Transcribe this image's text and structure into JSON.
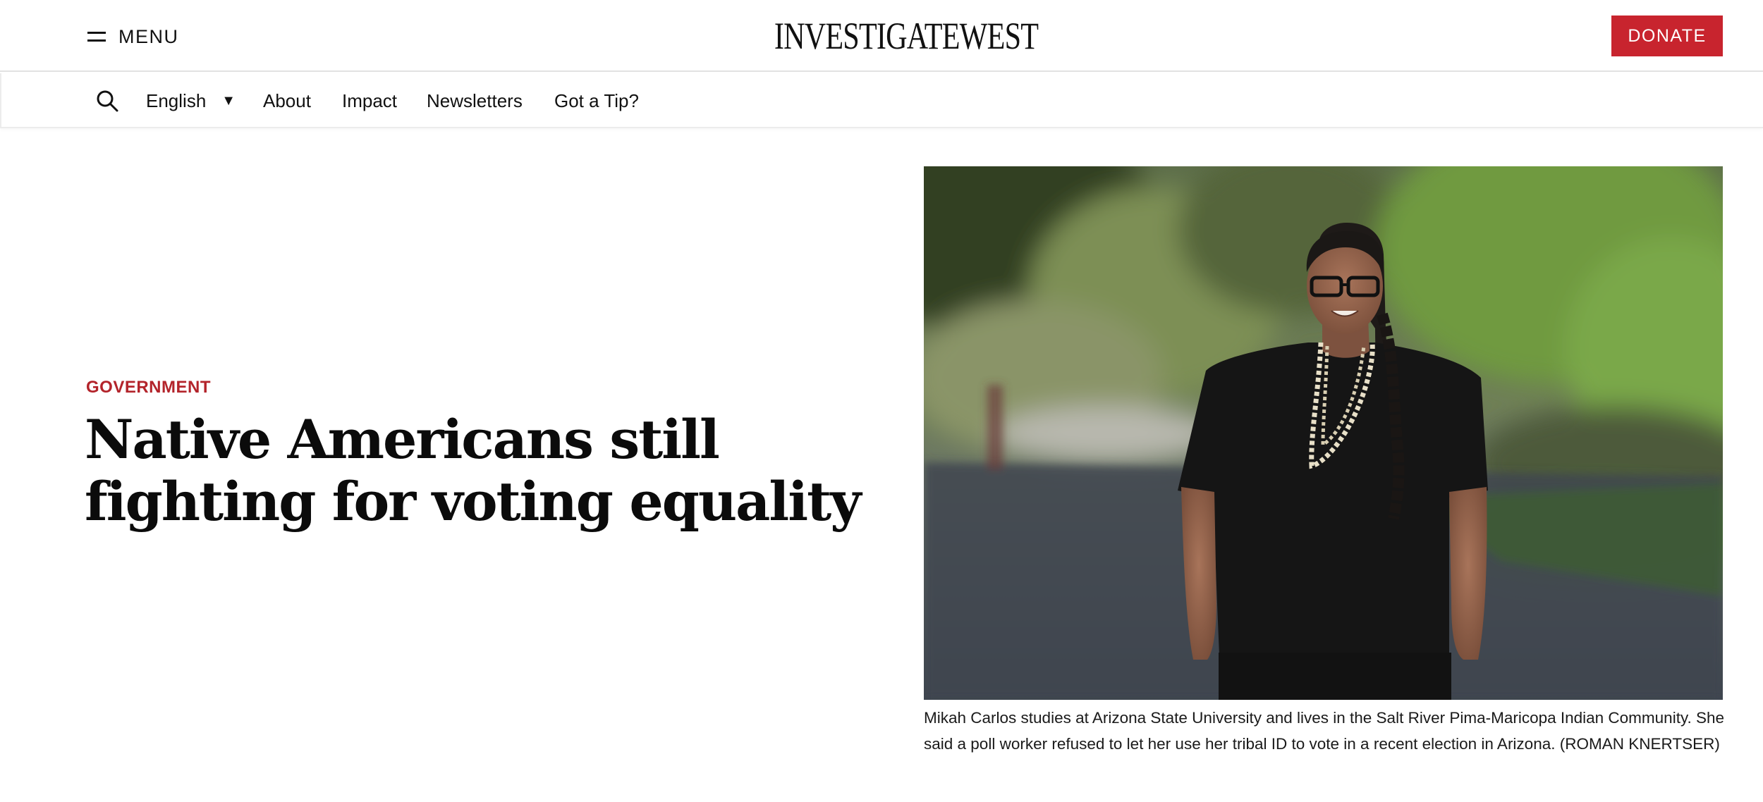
{
  "header": {
    "menu_label": "MENU",
    "logo_text": "INVESTIGATEWEST",
    "donate_label": "DONATE",
    "accent_color": "#c8242e"
  },
  "subnav": {
    "search_icon": "search-icon",
    "language": {
      "selected": "English",
      "caret": "▼"
    },
    "links": [
      "About",
      "Impact",
      "Newsletters",
      "Got a Tip?"
    ]
  },
  "article": {
    "category": "GOVERNMENT",
    "category_color": "#b3242b",
    "headline": "Native Americans still fighting for voting equality",
    "photo_caption": "Mikah Carlos studies at Arizona State University and lives in the Salt River Pima-Maricopa Indian Community. She said a poll worker refused to let her use her tribal ID to vote in a recent election in Arizona. (ROMAN KNERTSER)"
  }
}
